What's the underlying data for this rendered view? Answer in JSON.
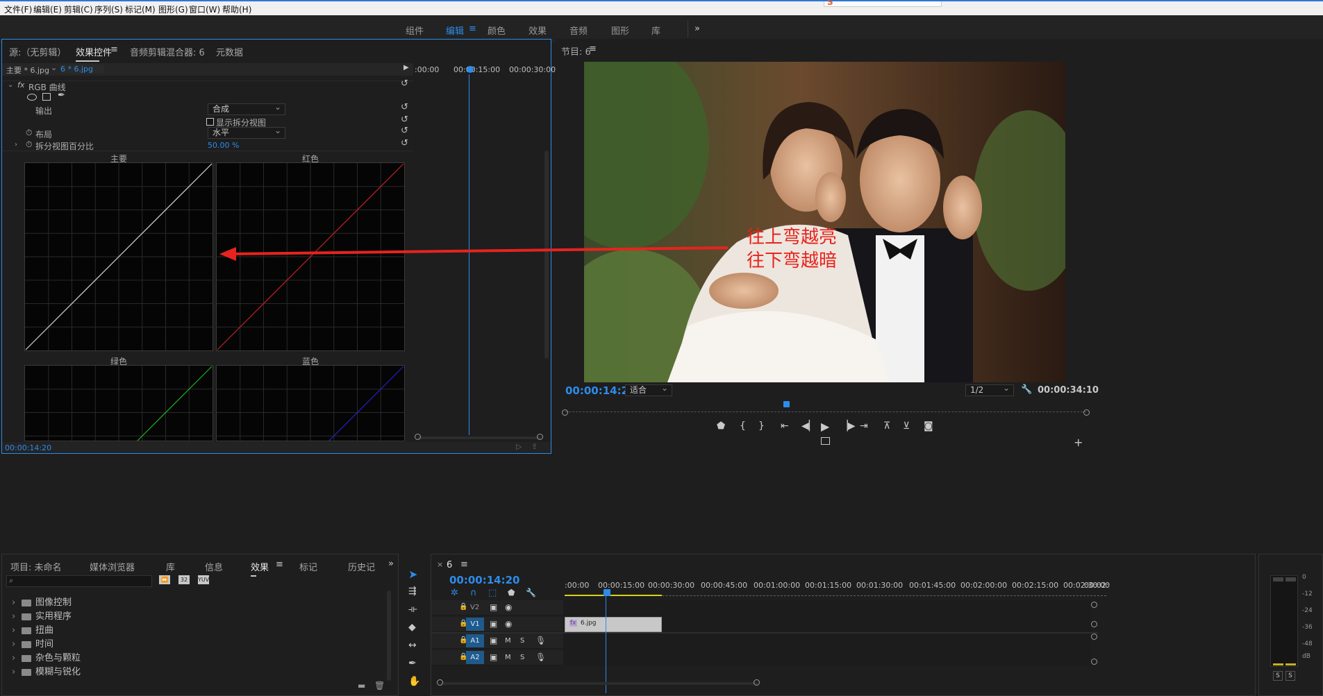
{
  "menu": [
    "文件(F)",
    "编辑(E)",
    "剪辑(C)",
    "序列(S)",
    "标记(M)",
    "图形(G)",
    "窗口(W)",
    "帮助(H)"
  ],
  "workspaces": [
    "组件",
    "编辑",
    "颜色",
    "效果",
    "音频",
    "图形",
    "库"
  ],
  "workspace_active": "编辑",
  "workspace_more": "»",
  "source_panel": {
    "tabs": [
      "源:（无剪辑）",
      "效果控件",
      "音频剪辑混合器: 6",
      "元数据"
    ],
    "active_tab": "效果控件",
    "clip_selector": "主要 * 6.jpg",
    "clip_current": "6 * 6.jpg",
    "effect_name": "RGB 曲线",
    "output_label": "输出",
    "output_value": "合成",
    "split_view_label": "显示拆分视图",
    "layout_label": "布局",
    "layout_value": "水平",
    "split_percent_label": "拆分视图百分比",
    "split_percent_value": "50.00 %",
    "curves": [
      "主要",
      "红色",
      "绿色",
      "蓝色"
    ],
    "ruler": [
      ":00:00",
      "00:00:15:00",
      "00:00:30:00"
    ],
    "footer_timecode": "00:00:14:20"
  },
  "annotation": {
    "line1": "往上弯越亮",
    "line2": "往下弯越暗"
  },
  "program_monitor": {
    "title": "节目: 6",
    "timecode_current": "00:00:14:20",
    "fit_value": "适合",
    "resolution": "1/2",
    "timecode_duration": "00:00:34:10"
  },
  "project_panel": {
    "tabs": [
      "项目: 未命名",
      "媒体浏览器",
      "库",
      "信息",
      "效果",
      "标记",
      "历史记"
    ],
    "active_tab": "效果",
    "items": [
      "图像控制",
      "实用程序",
      "扭曲",
      "时间",
      "杂色与颗粒",
      "模糊与锐化"
    ]
  },
  "timeline": {
    "sequence_name": "6",
    "timecode": "00:00:14:20",
    "ruler": [
      ":00:00",
      "00:00:15:00",
      "00:00:30:00",
      "00:00:45:00",
      "00:01:00:00",
      "00:01:15:00",
      "00:01:30:00",
      "00:01:45:00",
      "00:02:00:00",
      "00:02:15:00",
      "00:02:30:00",
      "00:02:45:00",
      "00:03:00:0"
    ],
    "tracks": [
      {
        "name": "V2",
        "type": "video"
      },
      {
        "name": "V1",
        "type": "video"
      },
      {
        "name": "A1",
        "type": "audio"
      },
      {
        "name": "A2",
        "type": "audio"
      }
    ],
    "track_m": "M",
    "track_s": "S",
    "clip_label": "6.jpg",
    "clip_fx": "fx"
  },
  "audio_meter": {
    "scale": [
      "0",
      "-12",
      "-24",
      "-36",
      "-48",
      "dB"
    ],
    "solo_left": "S",
    "solo_right": "S"
  },
  "colors": {
    "accent": "#2d8ceb",
    "annotation_red": "#e8231e"
  }
}
